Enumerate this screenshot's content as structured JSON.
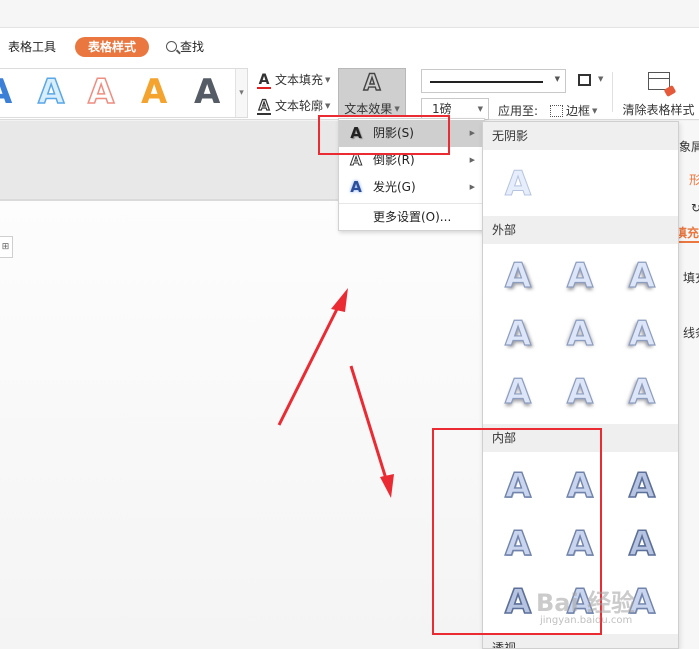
{
  "tabs": {
    "table_tools": "表格工具",
    "table_style": "表格样式",
    "find": "查找"
  },
  "ribbon": {
    "gallery_letters": [
      "A",
      "A",
      "A",
      "A",
      "A"
    ],
    "gallery_colors": [
      "#3b7fd6",
      "#5aa7e8",
      "#ef8d80",
      "#f4a32e",
      "#555c66"
    ],
    "text_fill": "文本填充",
    "text_outline": "文本轮廓",
    "text_effect": "文本效果",
    "line_weight": "1磅",
    "apply_to": "应用至:",
    "border": "边框",
    "clear_table_style": "清除表格样式",
    "text_fill_color": "#e02020"
  },
  "task_pane": {
    "t1": "象屑",
    "t2": "形",
    "t3": "填充",
    "t4": "填充",
    "t5": "线条"
  },
  "effect_menu": {
    "shadow": "阴影(S)",
    "reflection": "倒影(R)",
    "glow": "发光(G)",
    "more_settings": "更多设置(O)..."
  },
  "shadow_submenu": {
    "no_shadow": "无阴影",
    "outer": "外部",
    "inner": "内部",
    "perspective": "透视",
    "preview_letter": "A"
  },
  "watermark": {
    "brand": "Bai 经验",
    "url": "jingyan.baidu.com"
  },
  "colors": {
    "accent": "#e9773f",
    "annotation": "#ea2b33"
  }
}
